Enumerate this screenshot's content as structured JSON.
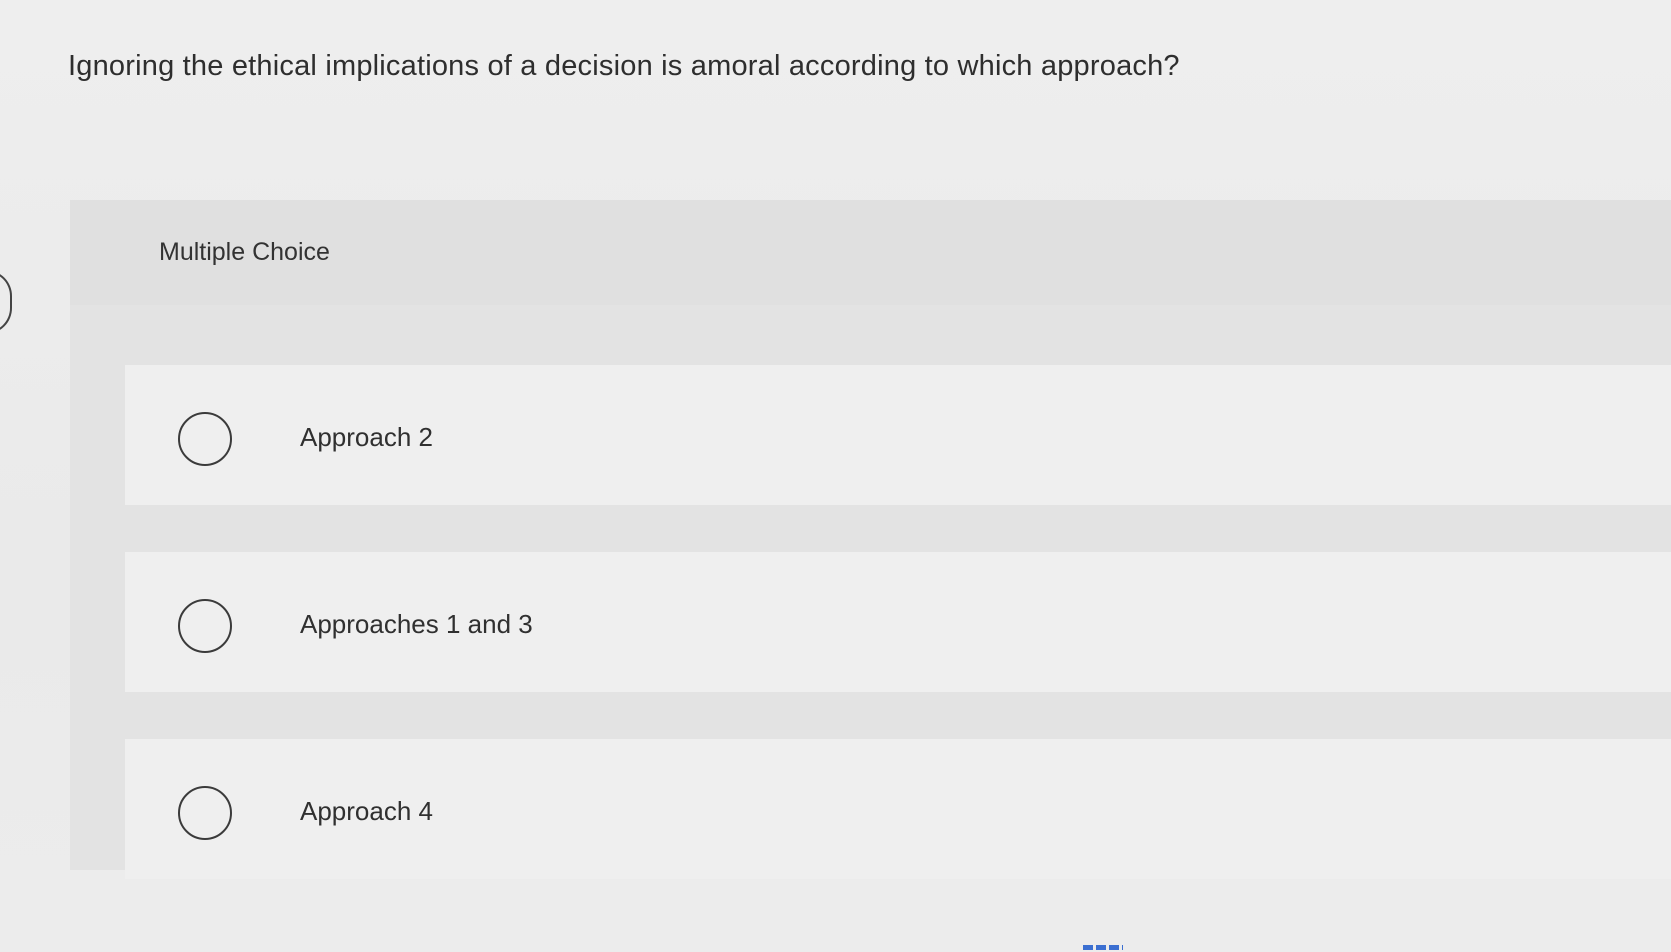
{
  "question": {
    "text": "Ignoring the ethical implications of a decision is amoral according to which approach?"
  },
  "panel": {
    "type_label": "Multiple Choice"
  },
  "choices": [
    {
      "label": "Approach 2"
    },
    {
      "label": "Approaches 1 and 3"
    },
    {
      "label": "Approach 4"
    }
  ],
  "colors": {
    "background": "#ececec",
    "panel": "#e3e3e3",
    "choice_background": "#efefef",
    "text": "#2f2f2f",
    "radio_border": "#3b3b3b"
  }
}
